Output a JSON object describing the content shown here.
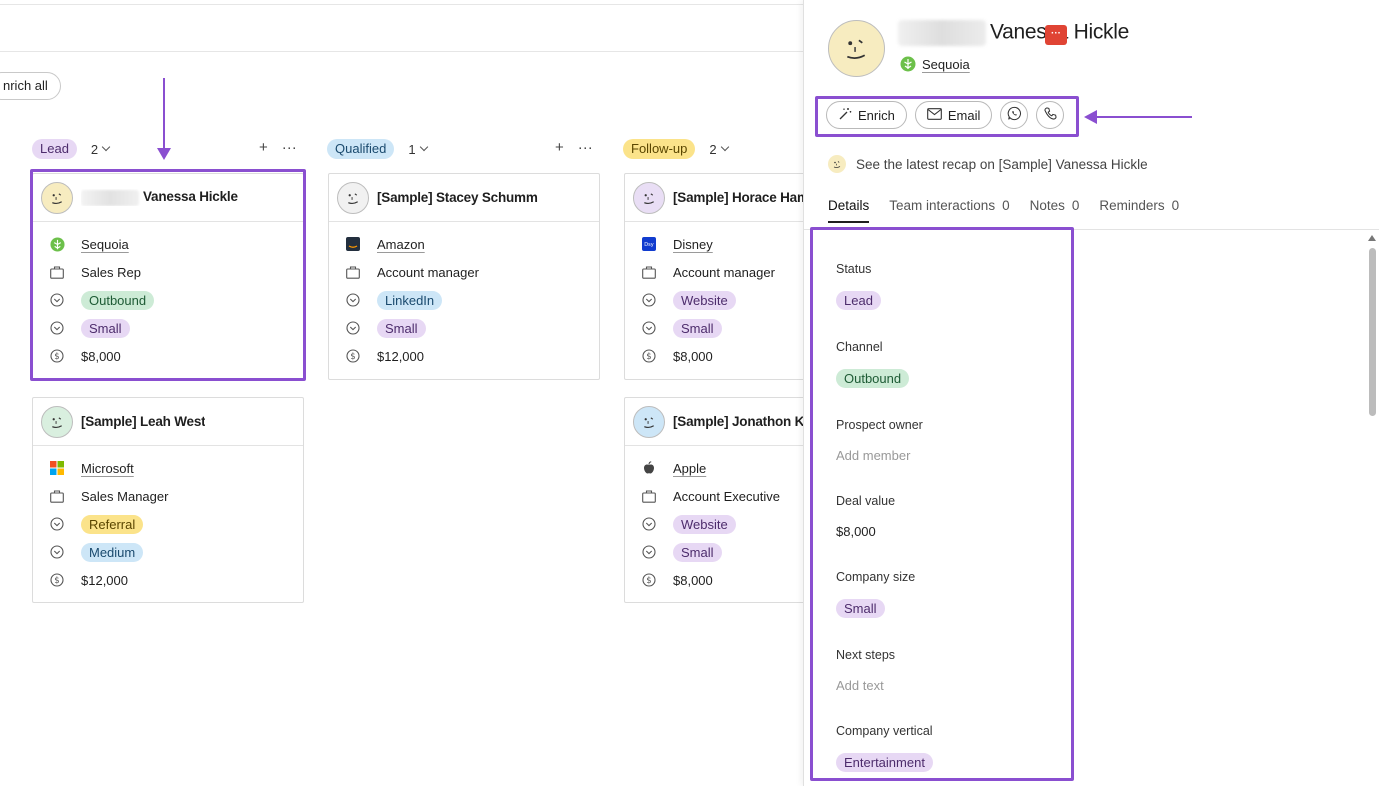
{
  "toolbar": {
    "enrich_all_label": "nrich all"
  },
  "columns": [
    {
      "stage": "Lead",
      "count": "2",
      "color": "#e7d8f4"
    },
    {
      "stage": "Qualified",
      "count": "1",
      "color": "#cde6f7"
    },
    {
      "stage": "Follow-up",
      "count": "2",
      "color": "#fbe38a"
    }
  ],
  "column_actions": {
    "add": "+",
    "more": "···"
  },
  "cards": {
    "vanessa": {
      "name": "Vanessa Hickle",
      "company": "Sequoia",
      "role": "Sales Rep",
      "channel": "Outbound",
      "size": "Small",
      "value": "$8,000"
    },
    "leah": {
      "name": "[Sample] Leah West",
      "company": "Microsoft",
      "role": "Sales Manager",
      "channel": "Referral",
      "size": "Medium",
      "value": "$12,000"
    },
    "stacey": {
      "name": "[Sample] Stacey Schumm",
      "company": "Amazon",
      "role": "Account manager",
      "channel": "LinkedIn",
      "size": "Small",
      "value": "$12,000"
    },
    "horace": {
      "name": "[Sample] Horace Ham",
      "company": "Disney",
      "role": "Account manager",
      "channel": "Website",
      "size": "Small",
      "value": "$8,000"
    },
    "jonathon": {
      "name": "[Sample] Jonathon Ku",
      "company": "Apple",
      "role": "Account Executive",
      "channel": "Website",
      "size": "Small",
      "value": "$8,000"
    }
  },
  "panel": {
    "name": "Vanessa Hickle",
    "badge": "···",
    "company": "Sequoia",
    "actions": {
      "enrich": "Enrich",
      "email": "Email"
    },
    "recap": "See the latest recap on [Sample] Vanessa Hickle",
    "tabs": [
      {
        "label": "Details",
        "count": ""
      },
      {
        "label": "Team interactions",
        "count": "0"
      },
      {
        "label": "Notes",
        "count": "0"
      },
      {
        "label": "Reminders",
        "count": "0"
      }
    ],
    "fields": {
      "status": {
        "label": "Status",
        "value": "Lead"
      },
      "channel": {
        "label": "Channel",
        "value": "Outbound"
      },
      "owner": {
        "label": "Prospect owner",
        "placeholder": "Add member"
      },
      "deal": {
        "label": "Deal value",
        "value": "$8,000"
      },
      "size": {
        "label": "Company size",
        "value": "Small"
      },
      "next": {
        "label": "Next steps",
        "placeholder": "Add text"
      },
      "vertical": {
        "label": "Company vertical",
        "value": "Entertainment"
      }
    }
  },
  "colors": {
    "highlight": "#8a4fd0",
    "tag_green": "#cdebd6",
    "tag_purple": "#e7d8f4",
    "tag_blue": "#cde6f7",
    "tag_yellow": "#fbe38a"
  }
}
